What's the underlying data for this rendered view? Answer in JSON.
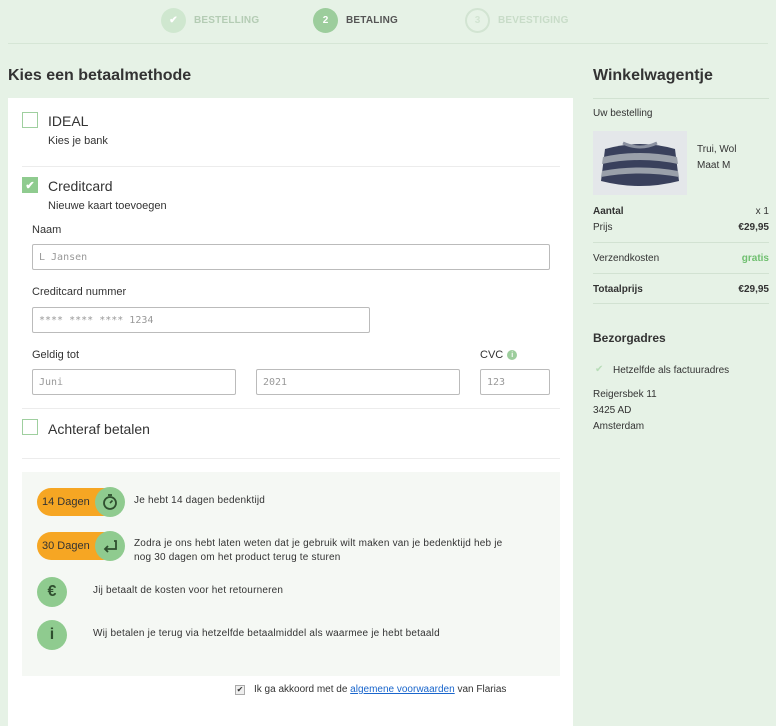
{
  "stepper": {
    "steps": [
      {
        "num": "✔",
        "label": "BESTELLING"
      },
      {
        "num": "2",
        "label": "BETALING"
      },
      {
        "num": "3",
        "label": "BEVESTIGING"
      }
    ]
  },
  "payment": {
    "title": "Kies een betaalmethode",
    "ideal": {
      "title": "IDEAL",
      "sub": "Kies je bank"
    },
    "creditcard": {
      "title": "Creditcard",
      "sub": "Nieuwe kaart toevoegen",
      "name_label": "Naam",
      "name_value": "L Jansen",
      "number_label": "Creditcard nummer",
      "number_value": "**** **** **** 1234",
      "valid_label": "Geldig tot",
      "month_value": "Juni",
      "year_value": "2021",
      "cvc_label": "CVC",
      "cvc_value": "123"
    },
    "afterpay": {
      "title": "Achteraf betalen"
    }
  },
  "benefits": [
    {
      "badge": "14 Dagen",
      "icon": "stopwatch-icon",
      "text": "Je hebt 14 dagen bedenktijd"
    },
    {
      "badge": "30 Dagen",
      "icon": "return-arrow-icon",
      "text_line1": "Zodra je ons hebt laten weten dat je gebruik wilt maken van je bedenktijd heb je",
      "text_line2": "nog 30 dagen om het product terug te sturen"
    },
    {
      "icon": "euro-icon",
      "glyph": "€",
      "text": "Jij betaalt de kosten voor het retourneren"
    },
    {
      "icon": "info-icon",
      "glyph": "i",
      "text": "Wij betalen je terug via hetzelfde betaalmiddel als waarmee je hebt betaald"
    }
  ],
  "agreement": {
    "prefix": "Ik ga akkoord met de ",
    "link": "algemene voorwaarden",
    "suffix": " van Flarias"
  },
  "cart": {
    "title": "Winkelwagentje",
    "order_label": "Uw bestelling",
    "product_name": "Trui, Wol",
    "product_size": "Maat M",
    "qty_label": "Aantal",
    "qty_value": "x 1",
    "price_label": "Prijs",
    "price_value": "€29,95",
    "shipping_label": "Verzendkosten",
    "shipping_value": "gratis",
    "total_label": "Totaalprijs",
    "total_value": "€29,95"
  },
  "address": {
    "title": "Bezorgadres",
    "same_label": "Hetzelfde als factuuradres",
    "line1": "Reigersbek 11",
    "line2": "3425 AD",
    "line3": "Amsterdam"
  },
  "colors": {
    "accent": "#8fcb8f",
    "badge": "#f6a623",
    "background": "#e6f2e6"
  }
}
